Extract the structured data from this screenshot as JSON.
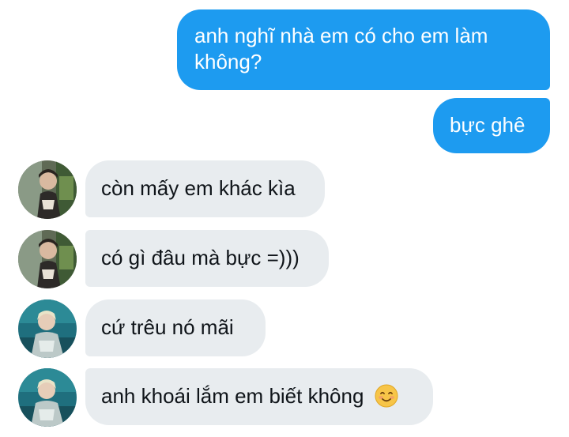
{
  "messages": [
    {
      "direction": "outgoing",
      "text": "anh nghĩ nhà em có cho em làm không?"
    },
    {
      "direction": "outgoing",
      "text": "bực ghê"
    },
    {
      "direction": "incoming",
      "avatar": "avatar-icon-1",
      "text": "còn mấy em khác kìa"
    },
    {
      "direction": "incoming",
      "avatar": "avatar-icon-1",
      "text": "có gì đâu mà bực =)))"
    },
    {
      "direction": "incoming",
      "avatar": "avatar-icon-2",
      "text": "cứ trêu nó mãi"
    },
    {
      "direction": "incoming",
      "avatar": "avatar-icon-2",
      "text": "anh khoái lắm em biết không",
      "emoji": "smiling-face-icon"
    }
  ],
  "colors": {
    "outgoing_bubble": "#1d9bf0",
    "incoming_bubble": "#e8ecef",
    "outgoing_text": "#ffffff",
    "incoming_text": "#0f1419"
  }
}
